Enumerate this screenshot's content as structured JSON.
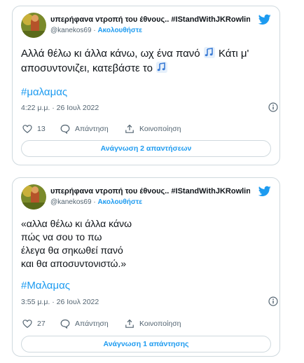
{
  "tweets": [
    {
      "display_name": "υπερήφανα ντροπή του έθνους.. #IStandWithJKRowling",
      "handle": "@kanekos69",
      "separator": "·",
      "follow_label": "Ακολουθήστε",
      "text_line_1": "Αλλά θέλω κι άλλα κάνω, ωχ ένα πανό",
      "text_line_1_end": "Κάτι μ'",
      "text_line_2": "αποσυντονιζει, κατεβάστε το",
      "hashtag": "#μαλαμας",
      "timestamp": "4:22 μ.μ. · 26 Ιουλ 2022",
      "likes": "13",
      "reply_label": "Απάντηση",
      "share_label": "Κοινοποίηση",
      "read_replies_label": "Ανάγνωση 2 απαντήσεων"
    },
    {
      "display_name": "υπερήφανα ντροπή του έθνους.. #IStandWithJKRowling",
      "handle": "@kanekos69",
      "separator": "·",
      "follow_label": "Ακολουθήστε",
      "lines": [
        "«αλλα θέλω κι άλλα κάνω",
        "πώς να σου το πω",
        "έλεγα θα σηκωθεί πανό",
        "και θα αποσυντονιστώ.»"
      ],
      "hashtag": "#Μαλαμας",
      "timestamp": "3:55 μ.μ. · 26 Ιουλ 2022",
      "likes": "27",
      "reply_label": "Απάντηση",
      "share_label": "Κοινοποίηση",
      "read_replies_label": "Ανάγνωση 1 απάντησης"
    }
  ],
  "colors": {
    "accent": "#1d9bf0",
    "muted": "#536471",
    "border": "#cfd9de"
  },
  "icons": [
    "twitter-bird-icon",
    "music-notes-icon",
    "info-icon",
    "heart-icon",
    "reply-icon",
    "share-icon"
  ]
}
